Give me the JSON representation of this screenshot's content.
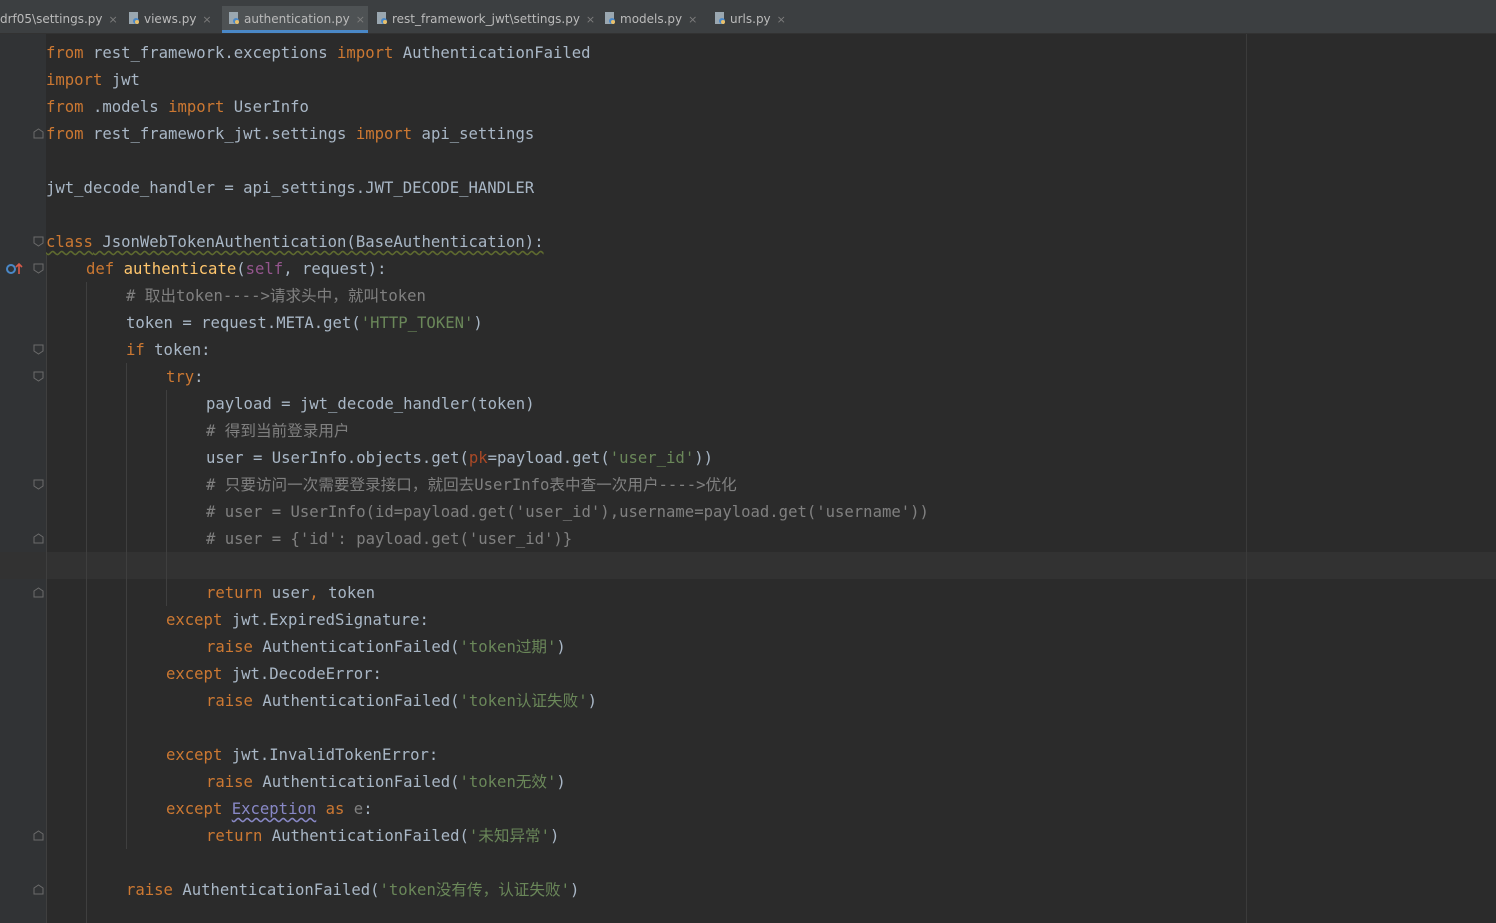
{
  "tabs": [
    {
      "label": "drf05\\settings.py",
      "active": false
    },
    {
      "label": "views.py",
      "active": false
    },
    {
      "label": "authentication.py",
      "active": true
    },
    {
      "label": "rest_framework_jwt\\settings.py",
      "active": false
    },
    {
      "label": "models.py",
      "active": false
    },
    {
      "label": "urls.py",
      "active": false
    }
  ],
  "close_glyph": "×",
  "code": {
    "l1": {
      "k1": "from",
      "t1": " rest_framework.exceptions ",
      "k2": "import",
      "t2": " AuthenticationFailed"
    },
    "l2": {
      "k1": "import",
      "t1": " jwt"
    },
    "l3": {
      "k1": "from",
      "t1": " .models ",
      "k2": "import",
      "t2": " UserInfo"
    },
    "l4": {
      "k1": "from",
      "t1": " rest_framework_jwt.settings ",
      "k2": "import",
      "t2": " api_settings"
    },
    "l6": {
      "t1": "jwt_decode_handler = api_settings.JWT_DECODE_HANDLER"
    },
    "l8": {
      "k1": "class",
      "t1": " JsonWebTokenAuthentication(BaseAuthentication):"
    },
    "l9": {
      "k1": "def",
      "f1": "authenticate",
      "p1": "(",
      "s1": "self",
      "p2": ", request):"
    },
    "l10": {
      "c1": "# 取出token---->请求头中，就叫token"
    },
    "l11": {
      "t1": "token = request.META.get(",
      "s1": "'HTTP_TOKEN'",
      "t2": ")"
    },
    "l12": {
      "k1": "if",
      "t1": " token:"
    },
    "l13": {
      "k1": "try",
      "t1": ":"
    },
    "l14": {
      "t1": "payload = jwt_decode_handler(token)"
    },
    "l15": {
      "c1": "# 得到当前登录用户"
    },
    "l16": {
      "t1": "user = UserInfo.objects.get(",
      "pk": "pk",
      "t2": "=payload.get(",
      "s1": "'user_id'",
      "t3": "))"
    },
    "l17": {
      "c1": "# 只要访问一次需要登录接口，就回去UserInfo表中查一次用户---->优化"
    },
    "l18": {
      "c1": "# user = UserInfo(id=payload.get('user_id'),username=payload.get('username'))"
    },
    "l19": {
      "c1": "# user = {'id': payload.get('user_id')}"
    },
    "l21": {
      "k1": "return",
      "t1": " user",
      "k2": ",",
      "t2": " token"
    },
    "l22": {
      "k1": "except",
      "t1": " jwt.ExpiredSignature:"
    },
    "l23": {
      "k1": "raise",
      "t1": " AuthenticationFailed(",
      "s1": "'token过期'",
      "t2": ")"
    },
    "l24": {
      "k1": "except",
      "t1": " jwt.DecodeError:"
    },
    "l25": {
      "k1": "raise",
      "t1": " AuthenticationFailed(",
      "s1": "'token认证失败'",
      "t2": ")"
    },
    "l27": {
      "k1": "except",
      "t1": " jwt.InvalidTokenError:"
    },
    "l28": {
      "k1": "raise",
      "t1": " AuthenticationFailed(",
      "s1": "'token无效'",
      "t2": ")"
    },
    "l29": {
      "k1": "except",
      "e1": "Exception",
      "k2": "as",
      "v1": "e",
      "t1": ":"
    },
    "l30": {
      "k1": "return",
      "t1": " AuthenticationFailed(",
      "s1": "'未知异常'",
      "t2": ")"
    },
    "l32": {
      "k1": "raise",
      "t1": " AuthenticationFailed(",
      "s1": "'token没有传，认证失败'",
      "t2": ")"
    }
  }
}
